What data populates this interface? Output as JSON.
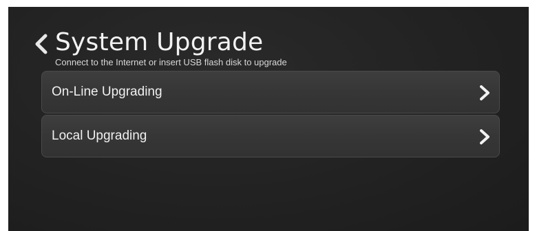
{
  "header": {
    "title": "System Upgrade",
    "subtitle": "Connect to the Internet or insert USB flash disk to upgrade",
    "back_icon": "chevron-left-icon"
  },
  "menu": {
    "items": [
      {
        "label": "On-Line Upgrading",
        "icon": "chevron-right-icon"
      },
      {
        "label": "Local Upgrading",
        "icon": "chevron-right-icon"
      }
    ]
  },
  "colors": {
    "background": "#232323",
    "item_background": "#383838",
    "text": "#f0f0f0"
  }
}
